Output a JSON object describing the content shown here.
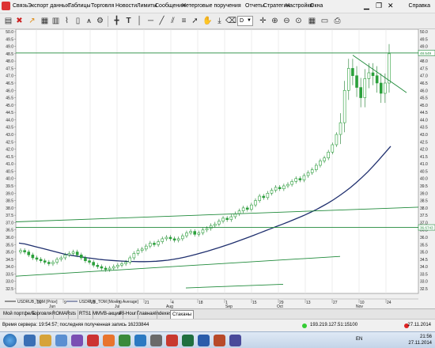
{
  "menu": {
    "items": [
      "Связь",
      "Экспорт данных",
      "Таблицы",
      "Торговля",
      "Новости",
      "Лимиты",
      "Сообщения",
      "Нетерговые поручения",
      "Отчеты",
      "Стратегии",
      "Настройки",
      "Окна"
    ],
    "right_label": "Справка"
  },
  "toolbar": {
    "dropdown_value": "D",
    "icons": [
      "cascade-icon",
      "tile-icon",
      "zoom-cursor-icon",
      "chart-type-icon",
      "bar-chart-icon",
      "line-chart-icon",
      "candles-icon",
      "indicator-icon",
      "settings-icon",
      "crosshair-icon",
      "text-icon",
      "vertical-line-icon",
      "horizontal-line-icon",
      "trend-line-icon",
      "channel-icon",
      "fibonacci-icon",
      "arrow-icon",
      "hand-icon",
      "pin-icon",
      "cross-icon",
      "zoom-in-icon",
      "zoom-out-icon",
      "scroll-icon"
    ]
  },
  "chart_data": {
    "type": "candlestick",
    "y_axis_ticks": [
      "50.0",
      "49.5",
      "49.0",
      "48.5",
      "48.0",
      "47.5",
      "47.0",
      "46.5",
      "46.0",
      "45.5",
      "45.0",
      "44.5",
      "44.0",
      "43.5",
      "43.0",
      "42.5",
      "42.0",
      "41.5",
      "41.0",
      "40.5",
      "40.0",
      "39.5",
      "39.0",
      "38.5",
      "38.0",
      "37.5",
      "37.0",
      "36.5",
      "36.0",
      "35.5",
      "35.0",
      "34.5",
      "34.0",
      "33.5",
      "33.0",
      "32.5"
    ],
    "ylim": [
      32.5,
      50.0
    ],
    "x_tick_labels": [
      "26",
      "9",
      "23",
      "7",
      "21",
      "4",
      "18",
      "1",
      "15",
      "29",
      "13",
      "27",
      "10",
      "24"
    ],
    "x_month_labels": [
      "Jun",
      "Jul",
      "Aug",
      "Sep",
      "Oct",
      "Nov"
    ],
    "price_labels": [
      {
        "text": "48.549",
        "value": 48.55
      },
      {
        "text": "36.6743",
        "value": 36.67
      }
    ],
    "horizontal_lines": [
      48.55,
      36.67
    ],
    "legend": [
      {
        "name": "USDRUB_TOM [Price]",
        "color": "#1c1c1c"
      },
      {
        "name": "USDRUB_TOM [Moving Average]",
        "color": "#1f2f6e"
      }
    ],
    "candle_color": "#2aa03a",
    "ma_color": "#1f2f6e",
    "trendline_color": "#1f8a3a",
    "grid": "vertical",
    "series": [
      {
        "name": "USDRUB_TOM [Price]",
        "closes": [
          35.1,
          35.0,
          34.8,
          34.6,
          34.5,
          34.4,
          34.3,
          34.2,
          34.3,
          34.5,
          34.6,
          34.8,
          34.9,
          35.0,
          34.8,
          34.6,
          34.4,
          34.3,
          34.1,
          34.0,
          33.9,
          33.8,
          33.9,
          34.0,
          34.1,
          34.2,
          34.3,
          34.6,
          34.9,
          35.1,
          35.2,
          35.4,
          35.6,
          35.5,
          35.7,
          35.9,
          36.0,
          35.9,
          35.8,
          35.9,
          36.1,
          36.3,
          36.4,
          36.2,
          36.3,
          36.5,
          36.6,
          36.8,
          36.9,
          37.1,
          37.3,
          37.2,
          37.4,
          37.6,
          37.8,
          38.0,
          37.9,
          38.2,
          38.5,
          38.8,
          38.7,
          39.0,
          39.2,
          39.4,
          39.3,
          39.5,
          39.6,
          39.8,
          40.0,
          39.9,
          40.2,
          40.4,
          40.6,
          40.9,
          41.2,
          41.4,
          41.8,
          42.3,
          43.0,
          43.8,
          46.0,
          47.5,
          47.0,
          46.2,
          45.5,
          46.8,
          47.2,
          47.0,
          46.5,
          45.8,
          46.5,
          48.5
        ]
      },
      {
        "name": "USDRUB_TOM [Moving Average]",
        "values": [
          35.6,
          35.55,
          35.45,
          35.35,
          35.25,
          35.15,
          35.05,
          34.95,
          34.85,
          34.78,
          34.72,
          34.66,
          34.6,
          34.55,
          34.5,
          34.46,
          34.43,
          34.4,
          34.38,
          34.36,
          34.35,
          34.34,
          34.34,
          34.35,
          34.37,
          34.4,
          34.44,
          34.5,
          34.57,
          34.65,
          34.74,
          34.84,
          34.95,
          35.06,
          35.18,
          35.3,
          35.43,
          35.56,
          35.7,
          35.84,
          35.98,
          36.13,
          36.28,
          36.43,
          36.58,
          36.73,
          36.88,
          37.03,
          37.19,
          37.35,
          37.52,
          37.7,
          37.89,
          38.1,
          38.32,
          38.56,
          38.82,
          39.1,
          39.4,
          39.73,
          40.08,
          40.46,
          40.87,
          41.3,
          41.75,
          42.2
        ]
      }
    ]
  },
  "tabs": [
    "Мой портфель",
    "Торговля",
    "ROMA",
    "Rsts",
    "RTS1",
    "MMVB-акции",
    "RI-Hour",
    "Главная",
    "Indexes",
    "Стаканы"
  ],
  "active_tab": "Стаканы",
  "status": {
    "left": "Время сервера: 19:54:57; последняя полученная запись 16233844",
    "right": "193.219.127.51:15100",
    "date": "27.11.2014"
  },
  "taskbar": {
    "lang": "EN",
    "time": "21:56",
    "date": "27.11.2014"
  }
}
